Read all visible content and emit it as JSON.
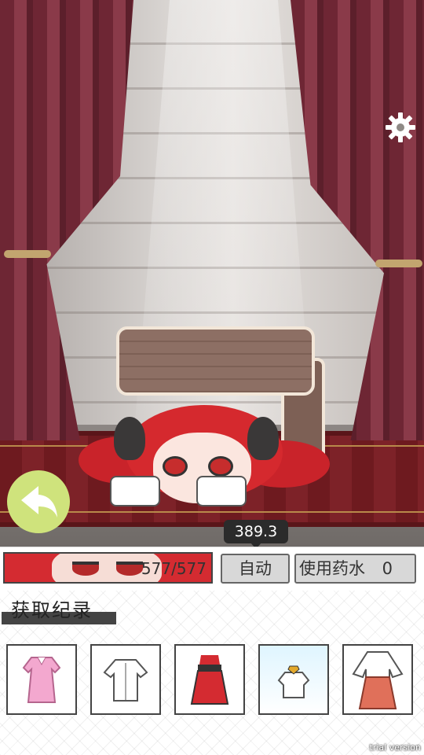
{
  "hud": {
    "hp_text": "577/577",
    "auto_label": "自动",
    "potion_label": "使用药水",
    "potion_count": "0",
    "damage_value": "389.3"
  },
  "records": {
    "title": "获取纪录",
    "items": [
      {
        "icon": "pink-dress-icon"
      },
      {
        "icon": "white-shirt-icon"
      },
      {
        "icon": "red-skirt-icon"
      },
      {
        "icon": "white-blouse-icon",
        "selected": true
      },
      {
        "icon": "hakama-outfit-icon"
      }
    ]
  },
  "watermark": "trial version",
  "colors": {
    "back_button": "#cfe37c",
    "hp_bar": "#d42b31",
    "button_bg": "#d8d8d8",
    "curtain": "#7a2c3b"
  }
}
